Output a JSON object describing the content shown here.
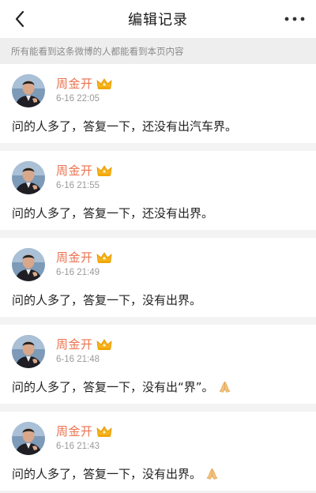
{
  "header": {
    "title": "编辑记录",
    "back_icon": "chevron-left-icon",
    "more_icon": "more-dots-icon"
  },
  "notice": "所有能看到这条微博的人都能看到本页内容",
  "accent_color": "#eb7350",
  "records": [
    {
      "username": "周金开",
      "time": "6-16 22:05",
      "content": "问的人多了，答复一下，还没有出汽车界。",
      "has_emoji": false
    },
    {
      "username": "周金开",
      "time": "6-16 21:55",
      "content": "问的人多了，答复一下，还没有出界。",
      "has_emoji": false
    },
    {
      "username": "周金开",
      "time": "6-16 21:49",
      "content": "问的人多了，答复一下，没有出界。",
      "has_emoji": false
    },
    {
      "username": "周金开",
      "time": "6-16 21:48",
      "content": "问的人多了，答复一下，没有出“界”。",
      "has_emoji": true,
      "emoji_icon": "praying-hands-icon"
    },
    {
      "username": "周金开",
      "time": "6-16 21:43",
      "content": "问的人多了，答复一下，没有出界。",
      "has_emoji": true,
      "emoji_icon": "praying-hands-icon"
    }
  ]
}
